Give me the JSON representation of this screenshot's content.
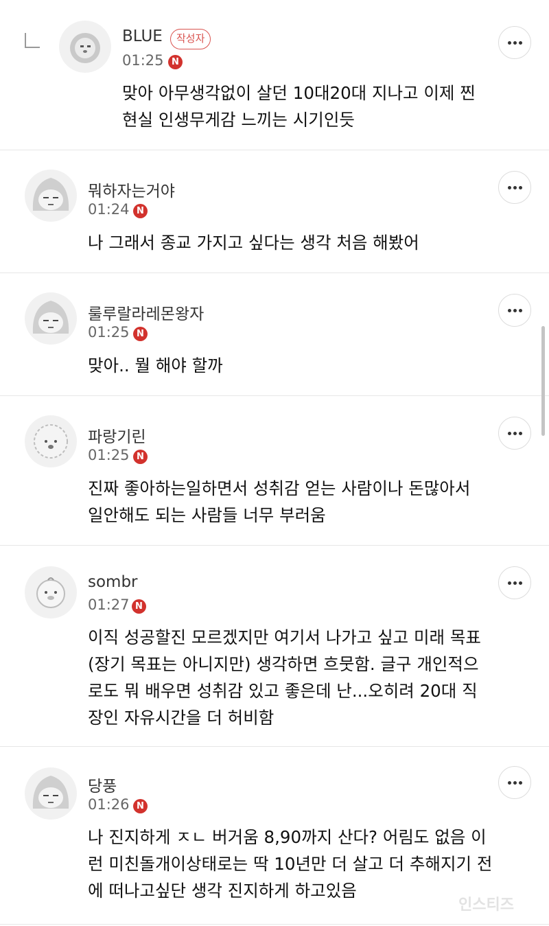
{
  "comments": [
    {
      "name": "BLUE",
      "author_badge": "작성자",
      "time": "01:25",
      "badge": "N",
      "avatar_icon": "lion-character-icon",
      "lines": [
        "맞아 아무생각없이 살던 10대20대 지나고 이제 찐",
        "현실 인생무게감 느끼는 시기인듯"
      ]
    },
    {
      "name": "뭐하자는거야",
      "time": "01:24",
      "badge": "N",
      "avatar_icon": "hooded-character-icon",
      "lines": [
        "나 그래서 종교 가지고 싶다는 생각 처음 해봤어"
      ]
    },
    {
      "name": "룰루랄라레몬왕자",
      "time": "01:25",
      "badge": "N",
      "avatar_icon": "hooded-character-icon",
      "lines": [
        "맞아.. 뭘 해야 할까"
      ]
    },
    {
      "name": "파랑기린",
      "time": "01:25",
      "badge": "N",
      "avatar_icon": "poodle-character-icon",
      "lines": [
        "진짜 좋아하는일하면서 성취감 얻는 사람이나 돈많아서",
        "일안해도 되는 사람들 너무 부러움"
      ]
    },
    {
      "name": "sombr",
      "time": "01:27",
      "badge": "N",
      "avatar_icon": "chick-character-icon",
      "lines": [
        "이직 성공할진 모르겠지만 여기서 나가고 싶고 미래 목표",
        "(장기 목표는 아니지만) 생각하면 흐뭇함. 글구 개인적으",
        "로도 뭐 배우면 성취감 있고 좋은데 난...오히려 20대 직",
        "장인 자유시간을 더 허비함"
      ]
    },
    {
      "name": "당풍",
      "time": "01:26",
      "badge": "N",
      "avatar_icon": "hooded-character-icon",
      "lines": [
        "나 진지하게 ㅈㄴ 버거움 8,90까지 산다? 어림도 없음 이",
        "런 미친돌개이상태로는 딱 10년만 더 살고 더 추해지기 전",
        "에 떠나고싶단 생각 진지하게 하고있음"
      ]
    }
  ],
  "watermark": "인스티즈"
}
